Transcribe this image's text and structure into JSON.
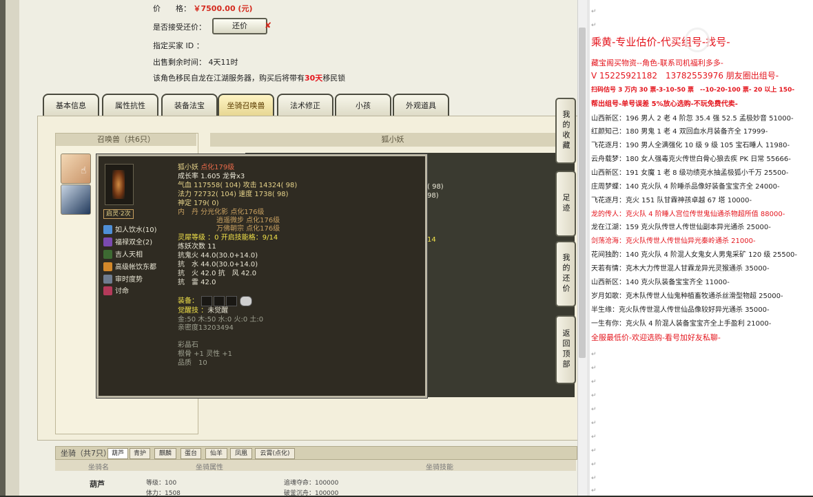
{
  "listing": {
    "price_label": "价　　格：",
    "price_value": "￥7500.00 (元)",
    "accept_haggle_label": "是否接受还价：",
    "haggle_button": "还价",
    "designated_buyer_label": "指定买家 ID ：",
    "time_left_label": "出售剩余时间：",
    "time_left_value": "4天11时",
    "migrate_note_prefix": "该角色移民自龙在江湖服务器，购买后将带有",
    "migrate_days": "30天",
    "migrate_note_suffix": "移民锁"
  },
  "tabs": [
    "基本信息",
    "属性抗性",
    "装备法宝",
    "坐骑召唤兽",
    "法术修正",
    "小孩",
    "外观道具"
  ],
  "active_tab": "坐骑召唤兽",
  "pets": {
    "header": "召唤兽（共6只）",
    "detail_header": "狐小妖"
  },
  "background_numbers": [
    "( 98)",
    "98)",
    "14"
  ],
  "side_buttons": [
    "我的收藏",
    "足迹",
    "我的还价",
    "返回顶部"
  ],
  "tooltip": {
    "name": "狐小妖",
    "name_suffix": "点化179级",
    "awaken_badge": "启灵·2次",
    "stats": [
      "成长率 1.605 龙骨x3",
      "气血 117558( 104) 攻击 14324( 98)",
      "法力 72732( 104) 速度 1738( 98)",
      "神定 179( 0)"
    ],
    "neidan": [
      "内　丹 分光化影 点化176级",
      "逍遥微步 点化176级",
      "万佛朝宗 点化176级"
    ],
    "lingxi": "灵犀等级 ：0 开启技能格：9/14",
    "lianyao": "炼妖次数 11",
    "resist": [
      "抗鬼火 44.0(30.0+14.0)",
      "抗　水 44.0(30.0+14.0)",
      "抗　火 42.0 抗　风 42.0",
      "抗　雷 42.0"
    ],
    "skills": [
      "如人饮水(10)",
      "福禄双全(2)",
      "吉人天相",
      "高级帐饮东都",
      "审时度势",
      "讨命"
    ],
    "equip_label": "装备：",
    "awaken_skill_label": "觉醒技 ：",
    "awaken_skill_value": "未觉醒",
    "elements": "金:50 木:50 水:0 火:0 土:0",
    "intimacy": "亲密度13203494",
    "crystal_label": "彩晶石",
    "crystal_value": "根骨 +1 灵性 +1",
    "quality": "品质　10"
  },
  "mounts": {
    "header": "坐骑（共7只）",
    "tabs": [
      "葫芦",
      "青护",
      "麒麟",
      "蛋台",
      "仙羊",
      "凤凰",
      "云霄(点化)"
    ],
    "col_name": "坐骑名",
    "col_attr": "坐骑属性",
    "col_skill": "坐骑技能",
    "row_name": "葫芦",
    "row_level": "等级：100",
    "row_life": "追魂夺命：100000",
    "row_vit": "体力：1508",
    "row_skill2": "破釜沉舟：100000"
  },
  "notes": [
    {
      "text": "乘黄-专业估价-代买组号-找号-",
      "style": "title"
    },
    {
      "text": "藏宝阁买物资--角色-联系司机福利多多-",
      "style": "red"
    },
    {
      "text": "V 15225921182　13782553976 朋友圈出组号-",
      "style": "redbig"
    },
    {
      "text": "扫码估号 3 万内 30 票-3-10-50 票　--10-20-100 票- 20 以上 150-",
      "style": "redbold"
    },
    {
      "text": "帮出组号-单号误差 5%放心选购-不玩免费代卖-",
      "style": "redbold"
    },
    {
      "text": "山西新区：196 男人 2 老 4 阶忽 35.4 强 52.5 孟极妙音 51000-",
      "style": "black"
    },
    {
      "text": "红颜知己：180 男鬼 1 老 4 双回血水月装备齐全 17999-",
      "style": "black"
    },
    {
      "text": "飞花逐月：190 男人全满强化 10 级 9 级 105 宝石睡人 11980-",
      "style": "black"
    },
    {
      "text": "云舟载梦：180 女人强毒克火传世白骨心狼去疾 PK 日常 55666-",
      "style": "black"
    },
    {
      "text": "山西新区：191 女魔 1 老 8 级功绩克水抽孟极狐小千万 25500-",
      "style": "black"
    },
    {
      "text": "庄周梦蝶：140 克火队 4 阶睡杀品像好装备宝宝齐全 24000-",
      "style": "black"
    },
    {
      "text": "飞花逐月：克火 151 队甘霖神孩卓越 67 塔 10000-",
      "style": "black"
    },
    {
      "text": "龙的传人：克火队 4 阶睡人宫位传世鬼仙通杀物超所值 88000-",
      "style": "red"
    },
    {
      "text": "龙在江湖：159 克火队传世人传世仙副本异光通杀 25000-",
      "style": "black"
    },
    {
      "text": "剑荡沧海：克火队传世人传世仙异光秦岭通杀 21000-",
      "style": "red"
    },
    {
      "text": "花间独酌：140 克火队 4 阶混人女鬼女人男鬼采矿 120 级 25500-",
      "style": "black"
    },
    {
      "text": "天若有情：克木大力传世混人甘霖龙异光灵猴通杀 35000-",
      "style": "black"
    },
    {
      "text": "山西新区：140 克火队装备宝宝齐全 11000-",
      "style": "black"
    },
    {
      "text": "岁月如歌：克木队传世人仙鬼种植畜牧通杀丝滑型物超 25000-",
      "style": "black"
    },
    {
      "text": "半生缘：克火队传世混人传世仙品像较好异光通杀 35000-",
      "style": "black"
    },
    {
      "text": "一生有你：克火队 4 阶混人装备宝宝齐全上手盈利 21000-",
      "style": "black"
    },
    {
      "text": "全服最低价-欢迎选购-看号加好友私聊-",
      "style": "red"
    }
  ],
  "colors": {
    "price_red": "#d42a1e",
    "note_red": "#e4151d",
    "tooltip_bg": "#2f2b22",
    "highlight_yellow": "#f2e24a"
  }
}
